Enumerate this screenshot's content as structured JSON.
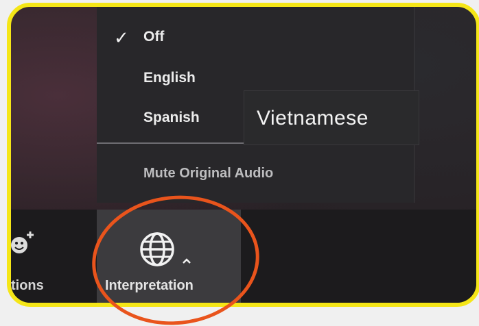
{
  "menu": {
    "items": [
      {
        "label": "Off",
        "checked": true
      },
      {
        "label": "English",
        "checked": false
      },
      {
        "label": "Spanish",
        "checked": false
      }
    ],
    "mute_label": "Mute Original Audio",
    "check_glyph": "✓"
  },
  "tooltip": {
    "text": "Vietnamese"
  },
  "toolbar": {
    "reactions_label": "tions",
    "interpretation_label": "Interpretation",
    "interpretation_icon": "globe-icon"
  },
  "colors": {
    "frame_border": "#f5e617",
    "highlight_ring": "#e9541c",
    "menu_bg": "#28272a",
    "toolbar_bg": "#1c1b1d"
  }
}
